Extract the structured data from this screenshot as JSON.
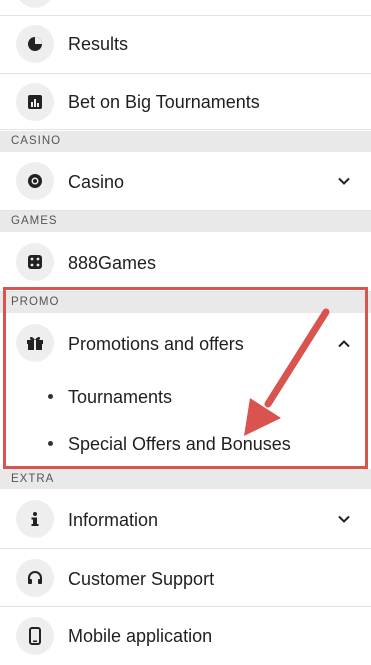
{
  "menu": {
    "results": {
      "label": "Results",
      "icon": "pie-chart-icon"
    },
    "big_tournaments": {
      "label": "Bet on Big Tournaments",
      "icon": "bar-chart-icon"
    },
    "casino_section": "CASINO",
    "casino": {
      "label": "Casino",
      "icon": "casino-chip-icon"
    },
    "games_section": "GAMES",
    "games": {
      "label": "888Games",
      "icon": "dice-icon"
    },
    "promo_section": "PROMO",
    "promotions": {
      "label": "Promotions and offers",
      "icon": "gift-icon"
    },
    "promotions_sub": [
      {
        "label": "Tournaments"
      },
      {
        "label": "Special Offers and Bonuses"
      }
    ],
    "extra_section": "EXTRA",
    "information": {
      "label": "Information",
      "icon": "info-icon"
    },
    "support": {
      "label": "Customer Support",
      "icon": "headset-icon"
    },
    "mobile": {
      "label": "Mobile application",
      "icon": "mobile-phone-icon"
    }
  },
  "colors": {
    "highlight": "#d9534f",
    "section_bg": "#e9e9e9",
    "icon_bg": "#eeeeee"
  }
}
